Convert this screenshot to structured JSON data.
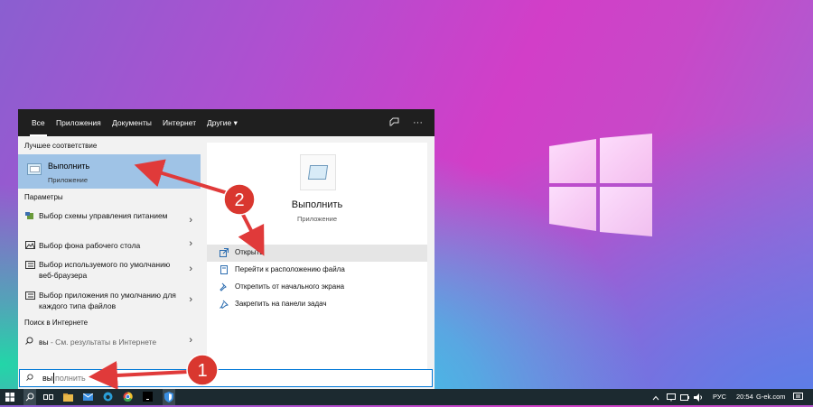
{
  "tabs": [
    {
      "label": "Все"
    },
    {
      "label": "Приложения"
    },
    {
      "label": "Документы"
    },
    {
      "label": "Интернет"
    },
    {
      "label": "Другие ▾"
    }
  ],
  "toolbar_icons": [
    "feedback-icon",
    "more-icon"
  ],
  "best_match": {
    "section_title": "Лучшее соответствие",
    "title": "Выполнить",
    "subtitle": "Приложение",
    "icon": "run-app-icon"
  },
  "settings": {
    "section_title": "Параметры",
    "items": [
      {
        "label": "Выбор схемы управления питанием",
        "icon": "power-icon"
      },
      {
        "label": "Выбор фона рабочего стола",
        "icon": "picture-icon"
      },
      {
        "label": "Выбор используемого по умолчанию веб-браузера",
        "icon": "list-icon"
      },
      {
        "label": "Выбор приложения по умолчанию для каждого типа файлов",
        "icon": "list-icon"
      }
    ]
  },
  "web_search": {
    "section_title": "Поиск в Интернете",
    "query": "вы",
    "suffix": " - См. результаты в Интернете"
  },
  "preview": {
    "app_name": "Выполнить",
    "app_type": "Приложение",
    "actions": [
      {
        "label": "Открыть",
        "icon": "open-icon",
        "highlighted": true
      },
      {
        "label": "Перейти к расположению файла",
        "icon": "folder-location-icon",
        "highlighted": false
      },
      {
        "label": "Открепить от начального экрана",
        "icon": "unpin-icon",
        "highlighted": false
      },
      {
        "label": "Закрепить на панели задач",
        "icon": "pin-icon",
        "highlighted": false
      }
    ]
  },
  "search": {
    "typed": "вы",
    "autocomplete": "полнить"
  },
  "annotations": [
    {
      "number": "1"
    },
    {
      "number": "2"
    }
  ],
  "taskbar": {
    "language": "РУС",
    "time": "20:54",
    "watermark": "G-ek.com",
    "icons": [
      "windows-start-icon",
      "search-icon",
      "task-view-icon",
      "explorer-icon",
      "mail-icon",
      "edge-icon",
      "chrome-icon",
      "terminal-icon",
      "defender-icon"
    ]
  },
  "colors": {
    "accent": "#0078d7",
    "selection": "#9fc3e6",
    "arrow": "#e03a3a",
    "taskbar": "#1c2a30"
  }
}
